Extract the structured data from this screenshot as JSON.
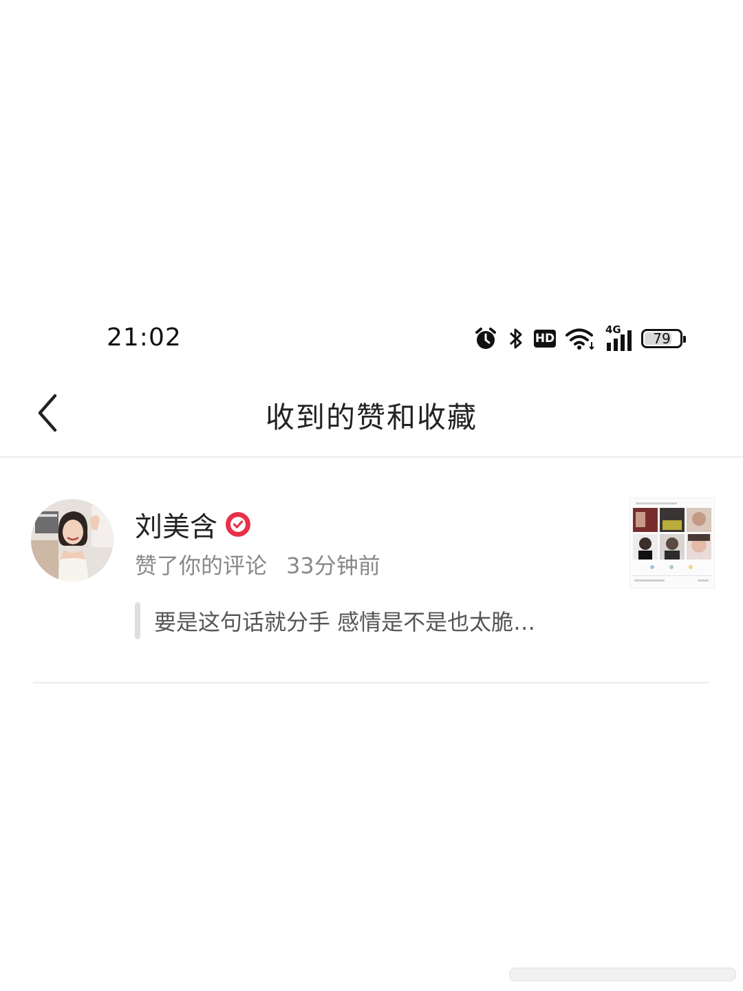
{
  "status_bar": {
    "time": "21:02",
    "icons": [
      "alarm-icon",
      "bluetooth-icon",
      "hd-icon",
      "wifi-icon",
      "signal-4g-icon",
      "battery-icon"
    ],
    "hd_label": "HD",
    "network_label": "4G",
    "battery_level": "79"
  },
  "nav": {
    "back_icon": "chevron-left-icon",
    "title": "收到的赞和收藏"
  },
  "notifications": [
    {
      "user_name": "刘美含",
      "verified": true,
      "action": "赞了你的评论",
      "time_ago": "33分钟前",
      "quote": "要是这句话就分手 感情是不是也太脆…",
      "colors": {
        "verified_badge": "#e8304a"
      }
    }
  ]
}
